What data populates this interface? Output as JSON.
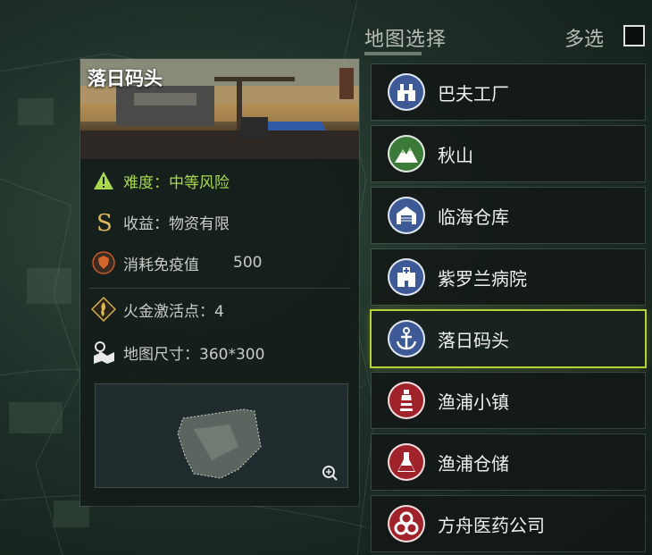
{
  "header": {
    "title": "地图选择",
    "multi_select_label": "多选"
  },
  "detail": {
    "title": "落日码头",
    "difficulty": "难度：中等风险",
    "reward": "收益：物资有限",
    "cost_label": "消耗免疫值",
    "cost_value": "500",
    "activation": "火金激活点：4",
    "map_size": "地图尺寸：360*300"
  },
  "maps": [
    {
      "label": "巴夫工厂",
      "icon": "factory-icon",
      "color": "#3d5a96"
    },
    {
      "label": "秋山",
      "icon": "mountain-icon",
      "color": "#3c7a3a"
    },
    {
      "label": "临海仓库",
      "icon": "warehouse-icon",
      "color": "#3d5a96"
    },
    {
      "label": "紫罗兰病院",
      "icon": "hospital-icon",
      "color": "#3d5a96"
    },
    {
      "label": "落日码头",
      "icon": "anchor-icon",
      "color": "#3d5a96",
      "selected": true
    },
    {
      "label": "渔浦小镇",
      "icon": "lighthouse-icon",
      "color": "#a0232c"
    },
    {
      "label": "渔浦仓储",
      "icon": "flask-icon",
      "color": "#a0232c"
    },
    {
      "label": "方舟医药公司",
      "icon": "biohazard-icon",
      "color": "#a0232c"
    }
  ],
  "colors": {
    "selected_border": "#b5d13a",
    "difficulty_text": "#a9d84e",
    "reward_icon": "#e0b95a"
  }
}
